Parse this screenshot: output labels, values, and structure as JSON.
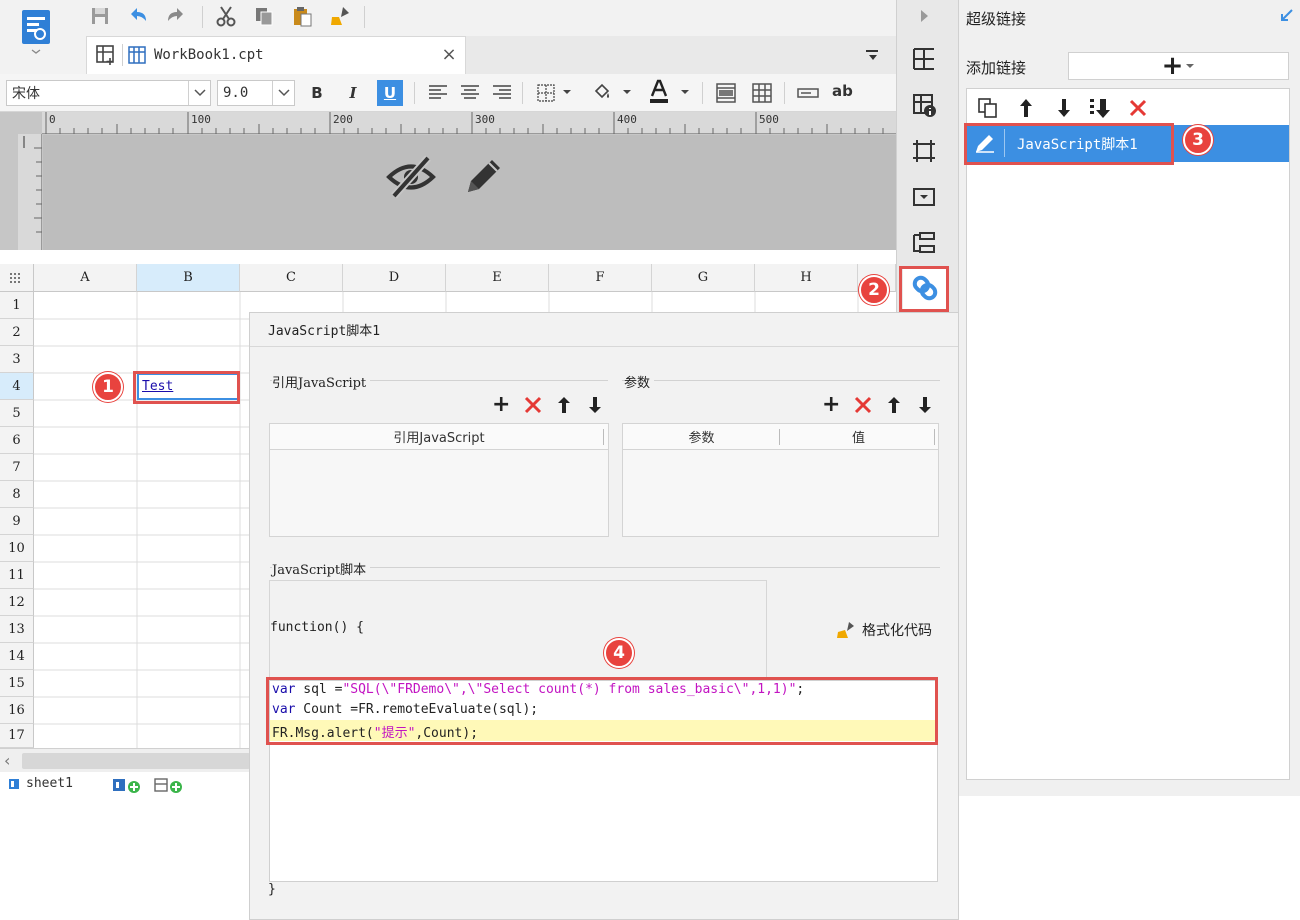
{
  "app": {
    "tab_title": "WorkBook1.cpt",
    "sheet_name": "sheet1"
  },
  "format_bar": {
    "font_name": "宋体",
    "font_size": "9.0",
    "bold": "B",
    "italic": "I",
    "underline": "U",
    "wrap_label": "ab"
  },
  "ruler": {
    "ticks": [
      "0",
      "100",
      "200",
      "300",
      "400",
      "500"
    ]
  },
  "grid": {
    "columns": [
      "A",
      "B",
      "C",
      "D",
      "E",
      "F",
      "G",
      "H"
    ],
    "rows": [
      "1",
      "2",
      "3",
      "4",
      "5",
      "6",
      "7",
      "8",
      "9",
      "10",
      "11",
      "12",
      "13",
      "14",
      "15",
      "16",
      "17"
    ],
    "cell_b4": "Test"
  },
  "hyperlink_panel": {
    "title": "超级链接",
    "add_label": "添加链接",
    "add_button": "+",
    "items": [
      {
        "label": "JavaScript脚本1",
        "selected": true
      }
    ]
  },
  "dialog": {
    "title": "JavaScript脚本1",
    "ref_group": "引用JavaScript",
    "ref_col": "引用JavaScript",
    "param_group": "参数",
    "param_col": "参数",
    "value_col": "值",
    "script_group": "JavaScript脚本",
    "func_open": "function() {",
    "func_close": "}",
    "format_code": "格式化代码",
    "code": {
      "l1_kw": "var",
      "l1_a": " sql =",
      "l1_str": "\"SQL(\\\"FRDemo\\\",\\\"Select count(*) from sales_basic\\\",1,1)\"",
      "l1_b": ";",
      "l2_kw": "var",
      "l2_a": " Count =FR.remoteEvaluate(sql);",
      "l3_a": "FR.Msg.alert(",
      "l3_str": "\"提示\"",
      "l3_b": ",Count);"
    }
  },
  "badges": [
    "1",
    "2",
    "3",
    "4"
  ],
  "colors": {
    "accent": "#3c8fe2",
    "selection": "#3c8fe2",
    "callout": "#e8433e",
    "highlight_line": "#fff9b8"
  }
}
